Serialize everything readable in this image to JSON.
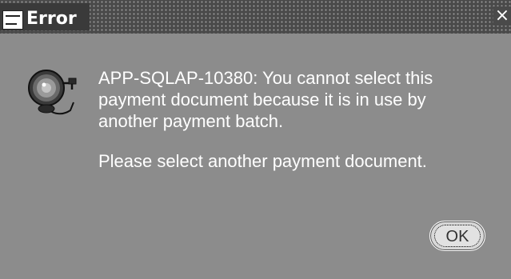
{
  "window": {
    "title": "Error",
    "close_glyph": "×",
    "logo_icon": "oracle-applications-icon"
  },
  "dialog": {
    "icon": "bell-alarm-icon",
    "message_main": "APP-SQLAP-10380: You cannot select this\npayment document because it is in use by\nanother payment batch.",
    "message_secondary": "Please select another payment document.",
    "ok_label": "OK"
  },
  "colors": {
    "titlebar": "#4a4a4a",
    "body": "#8c8c8c",
    "text": "#ffffff",
    "button": "#d8d8d8"
  }
}
